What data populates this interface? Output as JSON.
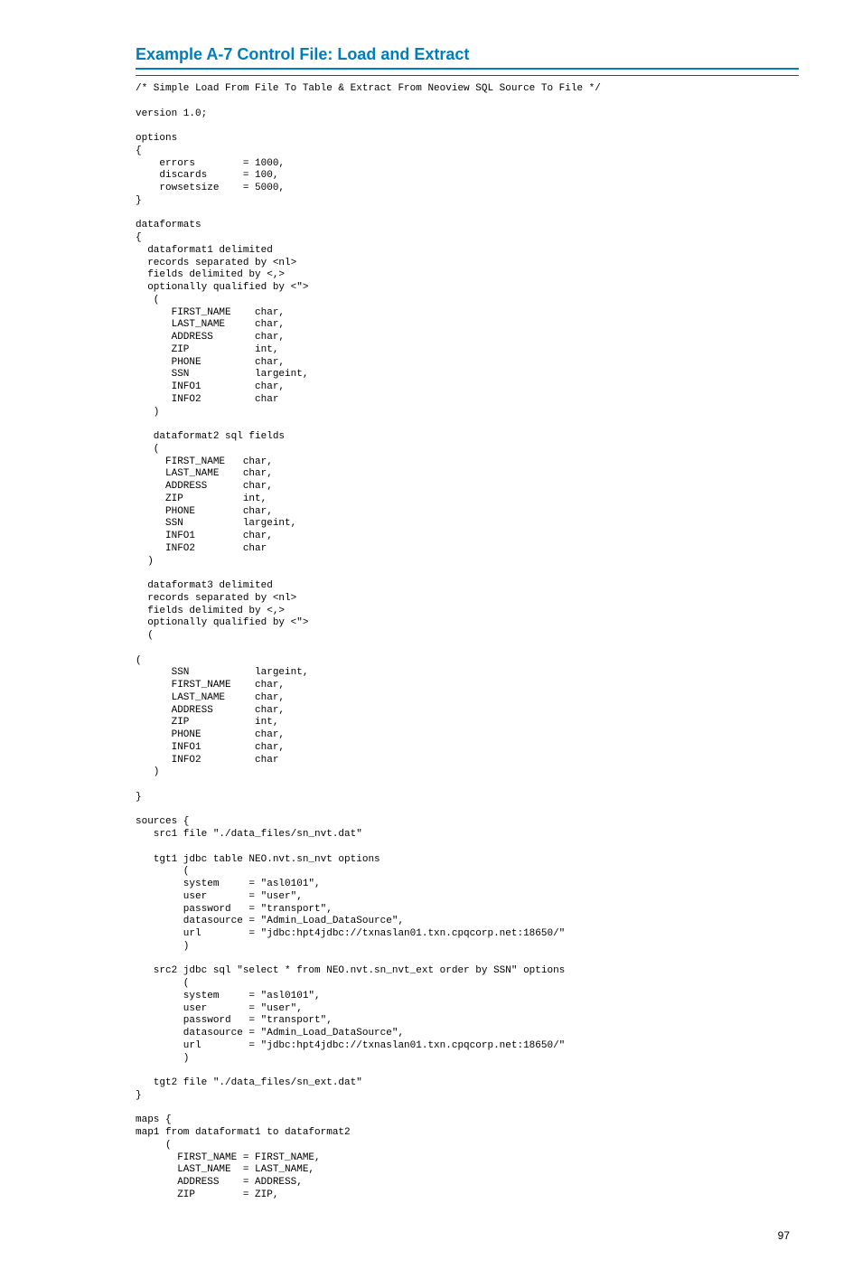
{
  "heading": "Example A-7 Control File: Load and Extract",
  "page_number": "97",
  "code": "/* Simple Load From File To Table & Extract From Neoview SQL Source To File */\n\nversion 1.0;\n\noptions\n{\n    errors        = 1000,\n    discards      = 100,\n    rowsetsize    = 5000,\n}\n\ndataformats\n{\n  dataformat1 delimited\n  records separated by <nl>\n  fields delimited by <,>\n  optionally qualified by <\">\n   (\n      FIRST_NAME    char,\n      LAST_NAME     char,\n      ADDRESS       char,\n      ZIP           int,\n      PHONE         char,\n      SSN           largeint,\n      INFO1         char,\n      INFO2         char\n   )\n\n   dataformat2 sql fields\n   (\n     FIRST_NAME   char,\n     LAST_NAME    char,\n     ADDRESS      char,\n     ZIP          int,\n     PHONE        char,\n     SSN          largeint,\n     INFO1        char,\n     INFO2        char\n  )\n\n  dataformat3 delimited\n  records separated by <nl>\n  fields delimited by <,>\n  optionally qualified by <\">\n  (\n\n(\n      SSN           largeint,\n      FIRST_NAME    char,\n      LAST_NAME     char,\n      ADDRESS       char,\n      ZIP           int,\n      PHONE         char,\n      INFO1         char,\n      INFO2         char\n   )\n\n}\n\nsources {\n   src1 file \"./data_files/sn_nvt.dat\"\n\n   tgt1 jdbc table NEO.nvt.sn_nvt options\n        (\n        system     = \"asl0101\",\n        user       = \"user\",\n        password   = \"transport\",\n        datasource = \"Admin_Load_DataSource\",\n        url        = \"jdbc:hpt4jdbc://txnaslan01.txn.cpqcorp.net:18650/\"\n        )\n\n   src2 jdbc sql \"select * from NEO.nvt.sn_nvt_ext order by SSN\" options\n        (\n        system     = \"asl0101\",\n        user       = \"user\",\n        password   = \"transport\",\n        datasource = \"Admin_Load_DataSource\",\n        url        = \"jdbc:hpt4jdbc://txnaslan01.txn.cpqcorp.net:18650/\"\n        )\n\n   tgt2 file \"./data_files/sn_ext.dat\"\n}\n\nmaps {\nmap1 from dataformat1 to dataformat2\n     (\n       FIRST_NAME = FIRST_NAME,\n       LAST_NAME  = LAST_NAME,\n       ADDRESS    = ADDRESS,\n       ZIP        = ZIP,"
}
